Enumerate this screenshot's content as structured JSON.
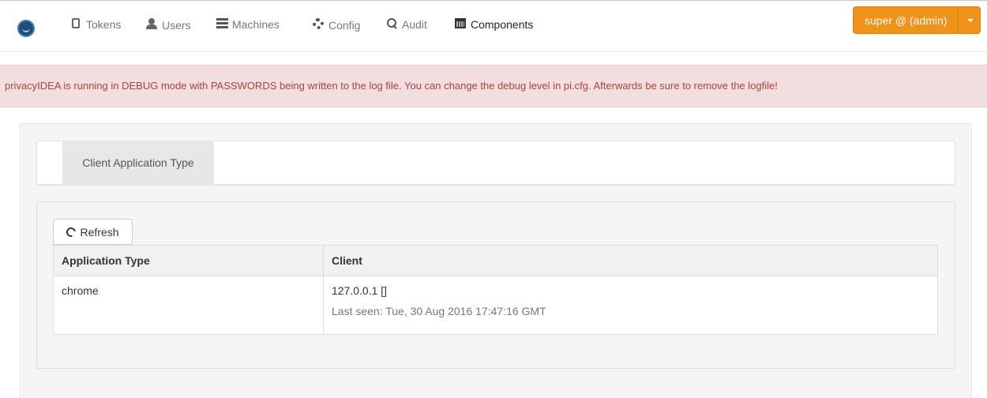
{
  "nav": {
    "items": [
      {
        "label": "Tokens",
        "icon": "tablet-icon"
      },
      {
        "label": "Users",
        "icon": "user-icon"
      },
      {
        "label": "Machines",
        "icon": "server-icon"
      },
      {
        "label": "Config",
        "icon": "gear-icon"
      },
      {
        "label": "Audit",
        "icon": "search-icon"
      },
      {
        "label": "Components",
        "icon": "calendar-icon",
        "active": true
      }
    ],
    "user_button": "super @ (admin)"
  },
  "alert": {
    "text": "privacyIDEA is running in DEBUG mode with PASSWORDS being written to the log file. You can change the debug level in pi.cfg. Afterwards be sure to remove the logfile!"
  },
  "tabs": [
    {
      "label": "Client Application Type",
      "active": true
    }
  ],
  "toolbar": {
    "refresh_label": "Refresh"
  },
  "table": {
    "headers": [
      "Application Type",
      "Client"
    ],
    "rows": [
      {
        "application_type": "chrome",
        "client": "127.0.0.1 []",
        "last_seen": "Last seen: Tue, 30 Aug 2016 17:47:16 GMT"
      }
    ]
  },
  "colors": {
    "accent": "#f0931a",
    "alert_bg": "#f2dede",
    "alert_text": "#a94442"
  }
}
